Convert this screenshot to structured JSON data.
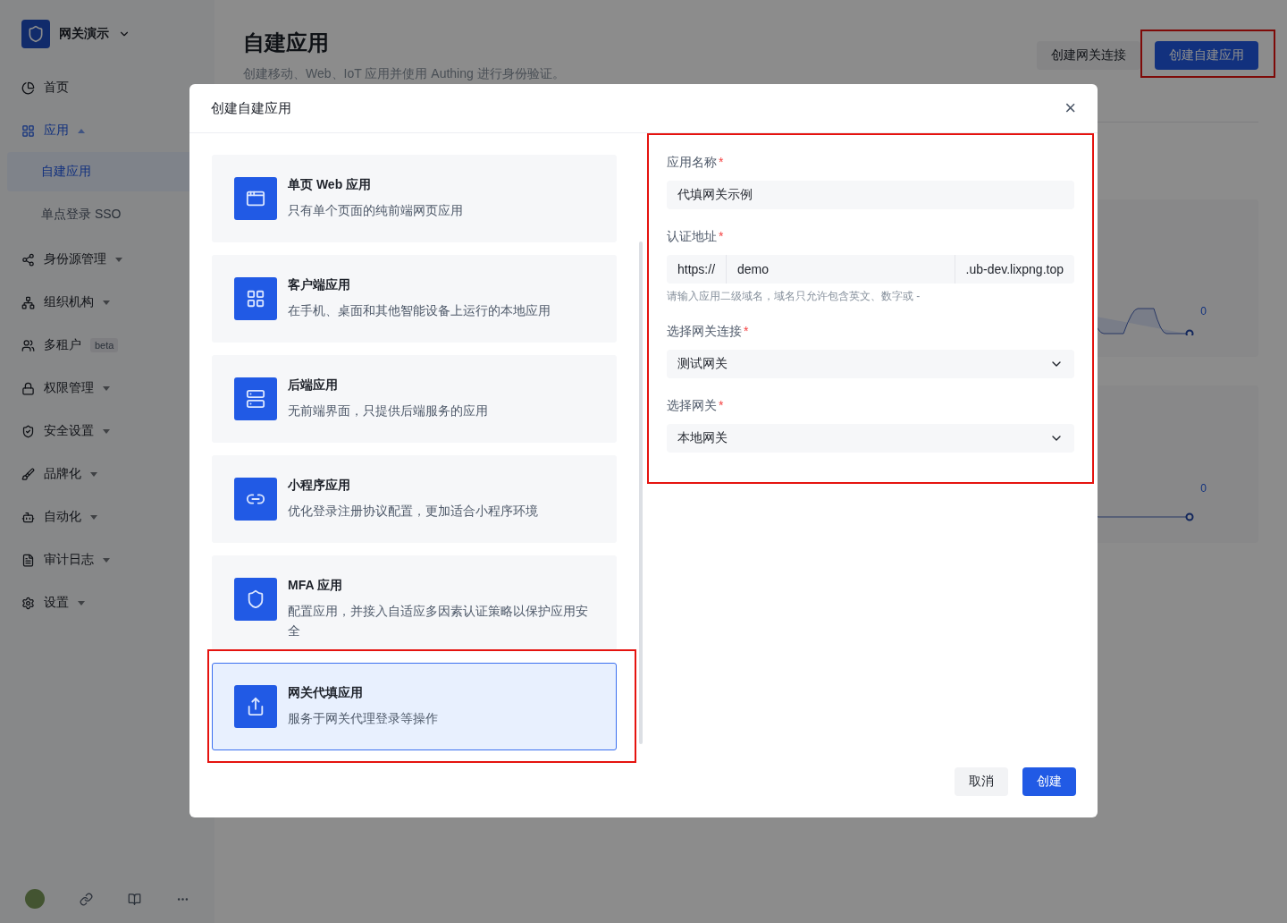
{
  "sidebar": {
    "org": {
      "name": "网关演示"
    },
    "items": [
      {
        "kind": "link",
        "label": "首页",
        "selected": false
      },
      {
        "kind": "group",
        "label": "应用",
        "selected": true,
        "expanded": true,
        "children": [
          {
            "label": "自建应用",
            "selected": true
          },
          {
            "label": "单点登录 SSO",
            "selected": false
          }
        ]
      },
      {
        "kind": "group",
        "label": "身份源管理",
        "selected": false,
        "expanded": false
      },
      {
        "kind": "group",
        "label": "组织机构",
        "selected": false,
        "expanded": false
      },
      {
        "kind": "link",
        "label": "多租户",
        "selected": false,
        "badge": "beta"
      },
      {
        "kind": "group",
        "label": "权限管理",
        "selected": false,
        "expanded": false
      },
      {
        "kind": "group",
        "label": "安全设置",
        "selected": false,
        "expanded": false
      },
      {
        "kind": "group",
        "label": "品牌化",
        "selected": false,
        "expanded": false
      },
      {
        "kind": "group",
        "label": "自动化",
        "selected": false,
        "expanded": false
      },
      {
        "kind": "group",
        "label": "审计日志",
        "selected": false,
        "expanded": false
      },
      {
        "kind": "group",
        "label": "设置",
        "selected": false,
        "expanded": false
      }
    ]
  },
  "page": {
    "title": "自建应用",
    "subtitle": "创建移动、Web、IoT 应用并使用 Authing 进行身份验证。",
    "buttons": [
      {
        "kind": "secondary",
        "label": "创建网关连接",
        "highlighted": false
      },
      {
        "kind": "primary",
        "label": "创建自建应用",
        "highlighted": true
      }
    ],
    "charts": [
      {
        "end_label": "0"
      },
      {
        "end_label": "0"
      }
    ]
  },
  "dialog": {
    "title": "创建自建应用",
    "close": "×",
    "app_types": [
      {
        "title": "单页 Web 应用",
        "description": "只有单个页面的纯前端网页应用",
        "selected": false,
        "highlighted": false
      },
      {
        "title": "客户端应用",
        "description": "在手机、桌面和其他智能设备上运行的本地应用",
        "selected": false,
        "highlighted": false
      },
      {
        "title": "后端应用",
        "description": "无前端界面，只提供后端服务的应用",
        "selected": false,
        "highlighted": false
      },
      {
        "title": "小程序应用",
        "description": "优化登录注册协议配置，更加适合小程序环境",
        "selected": false,
        "highlighted": false
      },
      {
        "title": "MFA 应用",
        "description": "配置应用，并接入自适应多因素认证策略以保护应用安全",
        "selected": false,
        "highlighted": false
      },
      {
        "title": "网关代填应用",
        "description": "服务于网关代理登录等操作",
        "selected": true,
        "highlighted": true
      }
    ],
    "form": {
      "highlighted": true,
      "fields": [
        {
          "kind": "text",
          "label": "应用名称",
          "required_mark": "*",
          "value": "代填网关示例"
        },
        {
          "kind": "url",
          "label": "认证地址",
          "required_mark": "*",
          "prefix": "https://",
          "value": "demo",
          "suffix": ".ub-dev.lixpng.top",
          "hint": "请输入应用二级域名，域名只允许包含英文、数字或 -"
        },
        {
          "kind": "select",
          "label": "选择网关连接",
          "required_mark": "*",
          "value": "测试网关"
        },
        {
          "kind": "select",
          "label": "选择网关",
          "required_mark": "*",
          "value": "本地网关"
        }
      ]
    },
    "buttons": [
      {
        "kind": "secondary",
        "label": "取消"
      },
      {
        "kind": "primary",
        "label": "创建"
      }
    ]
  }
}
